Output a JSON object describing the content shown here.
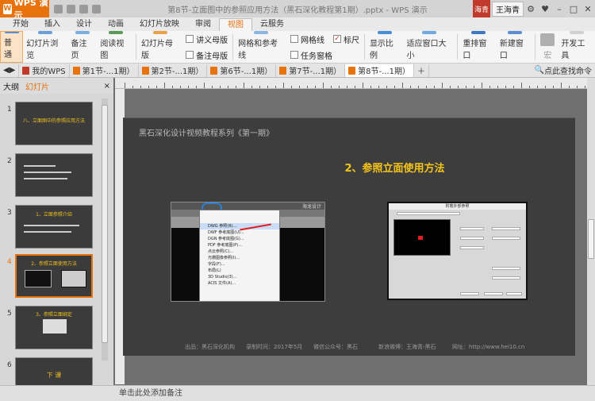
{
  "app": {
    "name": "WPS 演示",
    "title": "第8节-立面图中的参照应用方法（黑石深化教程第1期）.pptx - WPS 演示"
  },
  "user": {
    "badge": "海青",
    "name": "王海青"
  },
  "menu": {
    "tabs": [
      "开始",
      "插入",
      "设计",
      "动画",
      "幻灯片放映",
      "审阅",
      "视图",
      "云服务"
    ],
    "active": "视图"
  },
  "ribbon": {
    "normal": "普通",
    "slide_browse": "幻灯片浏览",
    "notes_page": "备注页",
    "reading_view": "阅读视图",
    "slide_master": "幻灯片母版",
    "handout_master": "讲义母版",
    "notes_master": "备注母版",
    "grid_guides": "网格和参考线",
    "gridlines": "网格线",
    "ruler": "标尺",
    "taskpane": "任务窗格",
    "zoom": "显示比例",
    "fit_window": "适应窗口大小",
    "arrange": "重排窗口",
    "new_window": "新建窗口",
    "macro": "宏",
    "dev_tools": "开发工具"
  },
  "doc_tabs": [
    "我的WPS",
    "第1节-...1期）",
    "第2节-...1期）",
    "第6节-...1期）",
    "第7节-...1期）",
    "第8节-...1期）"
  ],
  "search": "点此查找命令",
  "panel": {
    "outline": "大纲",
    "slides": "幻灯片"
  },
  "thumbs": [
    {
      "num": "1",
      "title": "八、立面图中的参照应用方法"
    },
    {
      "num": "2",
      "title": ""
    },
    {
      "num": "3",
      "title": "1、立面参照介绍"
    },
    {
      "num": "4",
      "title": "2、参照立面使用方法"
    },
    {
      "num": "5",
      "title": "3、参照立面绑定"
    },
    {
      "num": "6",
      "title": "下  课"
    }
  ],
  "slide": {
    "series": "黑石深化设计视频教程系列《第一期》",
    "heading": "2、参照立面使用方法",
    "screenshot_title": "海龙设计",
    "menu_items": [
      "DWG 参照(R)...",
      "DWF 参考底图(U)...",
      "DGN 参考底图(G)...",
      "PDF 参考底图(P)...",
      "点云参照(C)...",
      "光栅图像参照(I)...",
      "字段(F)...",
      "布局(L)",
      "3D Studio(3)...",
      "ACIS 文件(A)..."
    ],
    "dialog_title": "附着外部参照",
    "footer": {
      "producer": "出品：黑石深化机构",
      "date": "录制时间：2017年5月",
      "wechat": "微信公众号：黑石",
      "author": "新浪微博：王海青-黑石",
      "website": "网址：http://www.hei10.cn"
    }
  },
  "notes_placeholder": "单击此处添加备注"
}
